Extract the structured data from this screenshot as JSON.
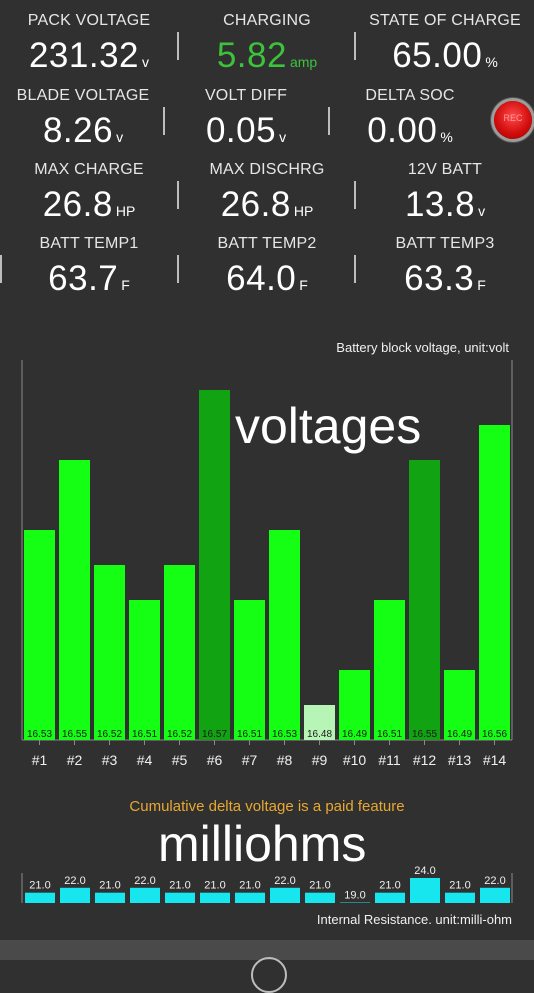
{
  "metrics": [
    {
      "label": "PACK VOLTAGE",
      "value": "231.32",
      "unit": "v"
    },
    {
      "label": "CHARGING",
      "value": "5.82",
      "unit": "amp",
      "color": "#3cc33c"
    },
    {
      "label": "STATE OF CHARGE",
      "value": "65.00",
      "unit": "%"
    },
    {
      "label": "BLADE VOLTAGE",
      "value": "8.26",
      "unit": "v"
    },
    {
      "label": "VOLT DIFF",
      "value": "0.05",
      "unit": "v"
    },
    {
      "label": "DELTA SOC",
      "value": "0.00",
      "unit": "%"
    },
    {
      "label": "MAX CHARGE",
      "value": "26.8",
      "unit": "HP"
    },
    {
      "label": "MAX DISCHRG",
      "value": "26.8",
      "unit": "HP"
    },
    {
      "label": "12V BATT",
      "value": "13.8",
      "unit": "v"
    },
    {
      "label": "BATT TEMP1",
      "value": "63.7",
      "unit": "F"
    },
    {
      "label": "BATT TEMP2",
      "value": "64.0",
      "unit": "F"
    },
    {
      "label": "BATT TEMP3",
      "value": "63.3",
      "unit": "F"
    }
  ],
  "record_button": {
    "label": "REC",
    "icon": "record-icon",
    "color": "#e01010"
  },
  "overlay": {
    "voltages": "voltages",
    "milliohms": "milliohms"
  },
  "paid_notice": "Cumulative delta voltage is a paid feature",
  "colors": {
    "bar": "#14ff14",
    "bar_max": "#11a311",
    "bar_min": "#b7f5b7",
    "resistance": "#18e6ee",
    "paid": "#e8a830"
  },
  "chart_data": [
    {
      "type": "bar",
      "title": "Battery block voltage, unit:volt",
      "categories": [
        "#1",
        "#2",
        "#3",
        "#4",
        "#5",
        "#6",
        "#7",
        "#8",
        "#9",
        "#10",
        "#11",
        "#12",
        "#13",
        "#14"
      ],
      "values": [
        16.53,
        16.55,
        16.52,
        16.51,
        16.52,
        16.57,
        16.51,
        16.53,
        16.48,
        16.49,
        16.51,
        16.55,
        16.49,
        16.56
      ],
      "ylim": [
        16.47,
        16.58
      ],
      "highlighted": {
        "max": [
          6,
          12
        ],
        "min": [
          9
        ]
      }
    },
    {
      "type": "bar",
      "title": "Internal Resistance. unit:milli-ohm",
      "categories": [
        "#1",
        "#2",
        "#3",
        "#4",
        "#5",
        "#6",
        "#7",
        "#8",
        "#9",
        "#10",
        "#11",
        "#12",
        "#13",
        "#14"
      ],
      "values": [
        21.0,
        22.0,
        21.0,
        22.0,
        21.0,
        21.0,
        21.0,
        22.0,
        21.0,
        19.0,
        21.0,
        24.0,
        21.0,
        22.0
      ],
      "ylim": [
        18.9,
        24.2
      ]
    }
  ]
}
